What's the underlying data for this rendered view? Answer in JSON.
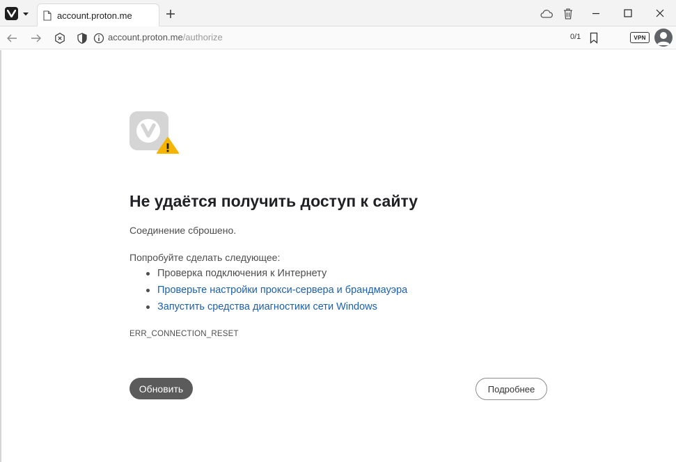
{
  "browser": {
    "tab": {
      "title": "account.proton.me"
    },
    "address": {
      "domain": "account.proton.me",
      "path": "/authorize"
    },
    "find_count": "0/1",
    "vpn_label": "VPN"
  },
  "error_page": {
    "title": "Не удаётся получить доступ к сайту",
    "subtitle": "Соединение сброшено.",
    "suggestions_heading": "Попробуйте сделать следующее:",
    "suggestions": [
      {
        "text": "Проверка подключения к Интернету",
        "link": false
      },
      {
        "text": "Проверьте настройки прокси-сервера и брандмауэра",
        "link": true
      },
      {
        "text": "Запустить средства диагностики сети Windows",
        "link": true
      }
    ],
    "error_code": "ERR_CONNECTION_RESET",
    "reload_label": "Обновить",
    "details_label": "Подробнее"
  },
  "colors": {
    "link": "#1a5fb4",
    "reload_button": "#5b5b5b",
    "warning_triangle": "#f4b400"
  },
  "icons": {
    "app": "vivaldi-icon",
    "favicon": "page-icon",
    "back": "arrow-left-icon",
    "forward": "arrow-right-icon",
    "stop": "close-circle-icon",
    "shield": "shield-icon",
    "info": "info-icon",
    "bookmark": "bookmark-icon",
    "sync": "cloud-icon",
    "trash": "trash-icon",
    "warning": "warning-icon"
  }
}
